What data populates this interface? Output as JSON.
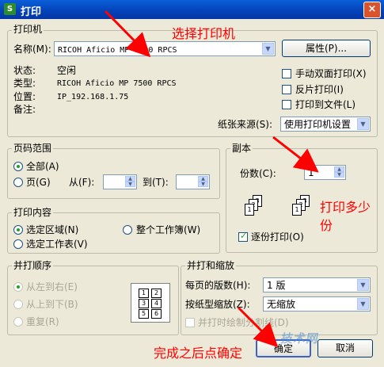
{
  "window": {
    "title": "打印",
    "app_icon": "S",
    "close": "×"
  },
  "printer": {
    "legend": "打印机",
    "name_label": "名称(M):",
    "name_value": "RICOH Aficio MP 7500 RPCS",
    "properties_button": "属性(P)...",
    "status_label": "状态:",
    "status_value": "空闲",
    "type_label": "类型:",
    "type_value": "RICOH Aficio MP 7500 RPCS",
    "location_label": "位置:",
    "location_value": "IP_192.168.1.75",
    "comment_label": "备注:",
    "manual_duplex": "手动双面打印(X)",
    "reverse_print": "反片打印(I)",
    "print_to_file": "打印到文件(L)",
    "paper_source_label": "纸张来源(S):",
    "paper_source_value": "使用打印机设置"
  },
  "page_range": {
    "legend": "页码范围",
    "all": "全部(A)",
    "pages": "页(G)",
    "from_label": "从(F):",
    "to_label": "到(T):"
  },
  "copies": {
    "legend": "副本",
    "count_label": "份数(C):",
    "count_value": "1",
    "collate": "逐份打印(O)",
    "collate_checked": true,
    "stack_pages": [
      "1",
      "2",
      "3"
    ]
  },
  "print_what": {
    "legend": "打印内容",
    "selection": "选定区域(N)",
    "workbook": "整个工作簿(W)",
    "sheets": "选定工作表(V)"
  },
  "print_order": {
    "legend": "并打顺序",
    "ltr": "从左到右(E)",
    "ttb": "从上到下(B)",
    "repeat": "重复(R)",
    "grid": [
      "1",
      "2",
      "3",
      "4",
      "5",
      "6"
    ]
  },
  "zoom": {
    "legend": "并打和缩放",
    "pages_per_sheet_label": "每页的版数(H):",
    "pages_per_sheet_value": "1 版",
    "scale_label": "按纸型缩放(Z):",
    "scale_value": "无缩放",
    "draw_lines": "并打时绘制分割线(D)"
  },
  "buttons": {
    "ok": "确定",
    "cancel": "取消"
  },
  "annotations": {
    "select_printer": "选择打印机",
    "copies_note_1": "打印多少",
    "copies_note_2": "份",
    "finish_note": "完成之后点确定",
    "color": "#ff0000"
  },
  "watermark": "技术网"
}
